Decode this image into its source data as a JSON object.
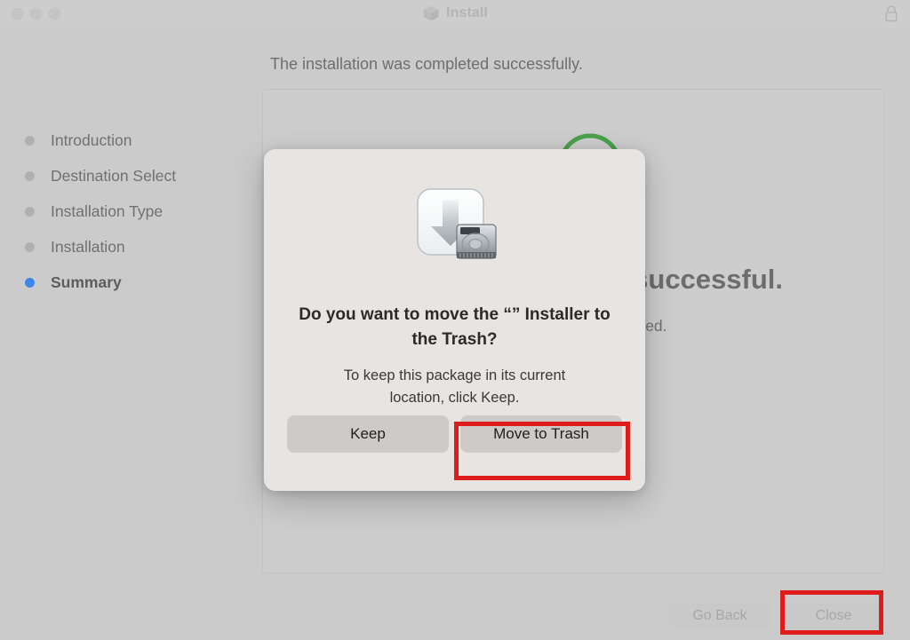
{
  "window": {
    "title": "Install",
    "title_icon": "package-box-icon",
    "lock_icon": "lock-closed-icon",
    "traffic_lights": [
      "close-button",
      "minimize-button",
      "zoom-button"
    ]
  },
  "sidebar": {
    "items": [
      {
        "label": "Introduction",
        "active": false
      },
      {
        "label": "Destination Select",
        "active": false
      },
      {
        "label": "Installation Type",
        "active": false
      },
      {
        "label": "Installation",
        "active": false
      },
      {
        "label": "Summary",
        "active": true
      }
    ]
  },
  "main": {
    "headline": "The installation was completed successfully.",
    "success_icon": "green-checkmark-icon",
    "success_title": "The installation was successful.",
    "success_subtitle": "The software was installed."
  },
  "footer": {
    "go_back_label": "Go Back",
    "close_label": "Close"
  },
  "dialog": {
    "icon": "installer-package-drive-icon",
    "title": "Do you want to move the “” Installer to the Trash?",
    "body": "To keep this package in its current location, click Keep.",
    "keep_label": "Keep",
    "move_to_trash_label": "Move to Trash"
  },
  "annotations": {
    "highlight_color": "#e01b1b",
    "boxes": [
      "move-to-trash-button",
      "close-button"
    ]
  },
  "colors": {
    "accent_blue": "#3a87e8",
    "window_bg": "#cbcbcb",
    "dialog_bg": "#e8e4e1",
    "highlight_red": "#e01b1b",
    "success_green": "#4aa14a"
  }
}
